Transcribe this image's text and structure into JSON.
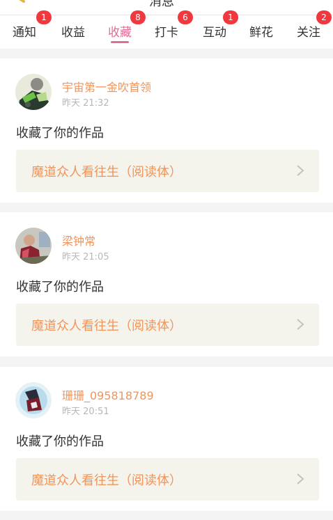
{
  "header": {
    "title_fragment": "消息"
  },
  "tabs": [
    {
      "label": "通知",
      "badge": "1",
      "active": false
    },
    {
      "label": "收益",
      "badge": "",
      "active": false
    },
    {
      "label": "收藏",
      "badge": "8",
      "active": true
    },
    {
      "label": "打卡",
      "badge": "6",
      "active": false
    },
    {
      "label": "互动",
      "badge": "1",
      "active": false
    },
    {
      "label": "鲜花",
      "badge": "",
      "active": false
    },
    {
      "label": "关注",
      "badge": "2",
      "active": false
    }
  ],
  "colors": {
    "accent": "#e46b94",
    "username": "#f0955a",
    "badge": "#f0393f"
  },
  "notifications": [
    {
      "username": "宇宙第一金吹首领",
      "time": "昨天 21:32",
      "action": "收藏了你的作品",
      "work_title": "魔道众人看往生（阅读体）",
      "avatar_icon": "anime-avatar-green"
    },
    {
      "username": "梁钟常",
      "time": "昨天 21:05",
      "action": "收藏了你的作品",
      "work_title": "魔道众人看往生（阅读体）",
      "avatar_icon": "anime-avatar-red"
    },
    {
      "username": "珊珊_095818789",
      "time": "昨天 20:51",
      "action": "收藏了你的作品",
      "work_title": "魔道众人看往生（阅读体）",
      "avatar_icon": "anime-avatar-blue"
    }
  ]
}
